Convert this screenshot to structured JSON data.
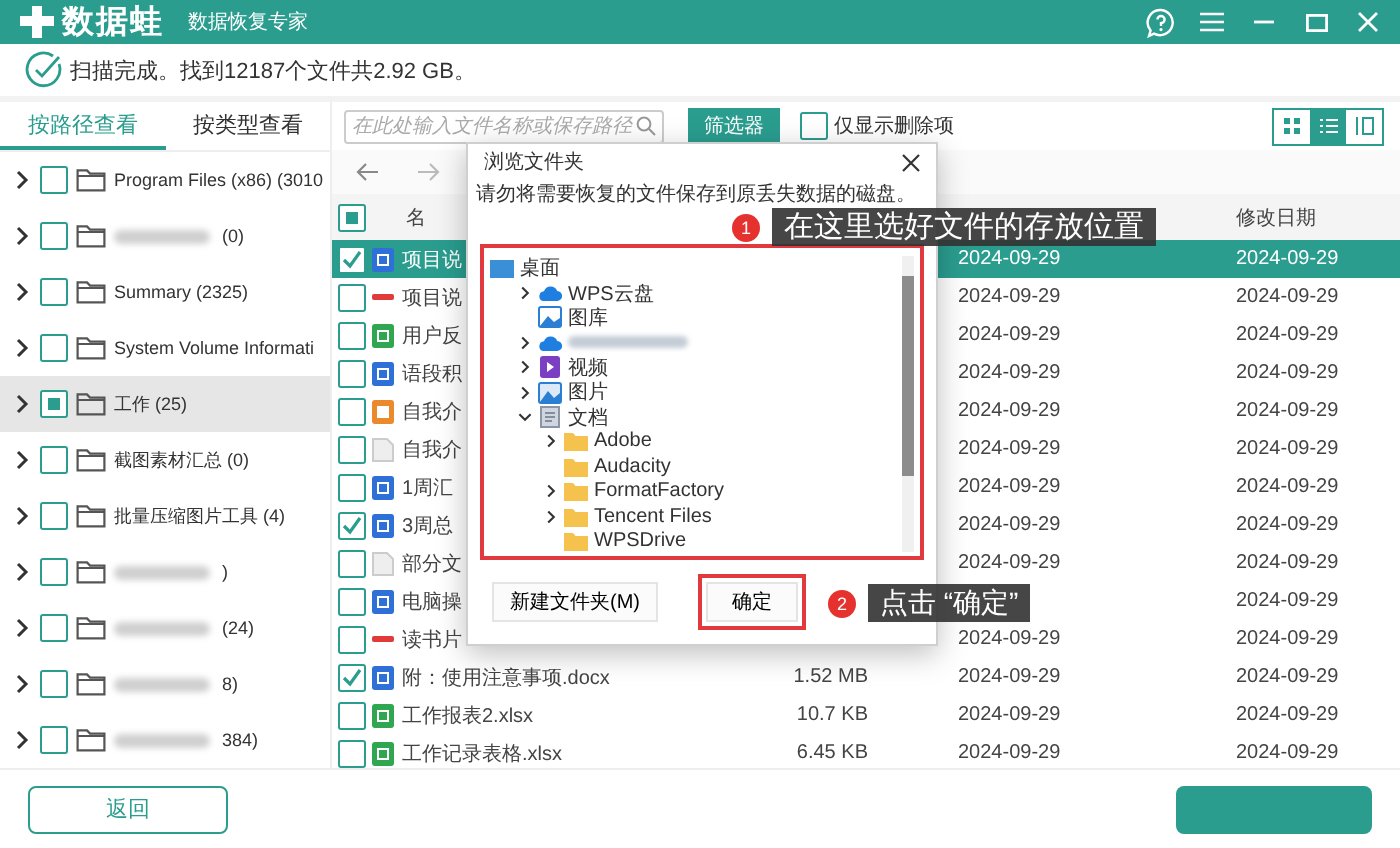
{
  "app": {
    "logo_text": "数据蛙",
    "subtitle": "数据恢复专家"
  },
  "scan_status": "扫描完成。找到12187个文件共2.92 GB。",
  "view_tabs": [
    {
      "label": "按路径查看",
      "selected": true
    },
    {
      "label": "按类型查看",
      "selected": false
    }
  ],
  "tree": [
    {
      "label": "Program Files (x86) (3010",
      "blurred": false,
      "checked": false,
      "indeterminate": false,
      "expanded": false,
      "selected": false
    },
    {
      "label": "(0)",
      "blurred": true,
      "checked": false,
      "indeterminate": false,
      "expanded": false,
      "selected": false
    },
    {
      "label": "Summary (2325)",
      "blurred": false,
      "checked": false,
      "indeterminate": false,
      "expanded": false,
      "selected": false
    },
    {
      "label": "System Volume Informati",
      "blurred": false,
      "checked": false,
      "indeterminate": false,
      "expanded": false,
      "selected": false
    },
    {
      "label": "工作 (25)",
      "blurred": false,
      "checked": false,
      "indeterminate": true,
      "expanded": false,
      "selected": true
    },
    {
      "label": "截图素材汇总 (0)",
      "blurred": false,
      "checked": false,
      "indeterminate": false,
      "expanded": false,
      "selected": false
    },
    {
      "label": "批量压缩图片工具 (4)",
      "blurred": false,
      "checked": false,
      "indeterminate": false,
      "expanded": false,
      "selected": false
    },
    {
      "label": ")",
      "blurred": true,
      "checked": false,
      "indeterminate": false,
      "expanded": false,
      "selected": false
    },
    {
      "label": "(24)",
      "blurred": true,
      "checked": false,
      "indeterminate": false,
      "expanded": false,
      "selected": false
    },
    {
      "label": "8)",
      "blurred": true,
      "checked": false,
      "indeterminate": false,
      "expanded": false,
      "selected": false
    },
    {
      "label": "384)",
      "blurred": true,
      "checked": false,
      "indeterminate": false,
      "expanded": false,
      "selected": false
    }
  ],
  "search": {
    "placeholder": "在此处输入文件名称或保存路径"
  },
  "filter_button": "筛选器",
  "deleted_only": {
    "label": "仅显示删除项",
    "checked": false
  },
  "views": [
    {
      "kind": "grid",
      "selected": false
    },
    {
      "kind": "list",
      "selected": true
    },
    {
      "kind": "columns",
      "selected": false
    }
  ],
  "table": {
    "header": {
      "name": "名",
      "modified": "修改日期"
    },
    "header_checked": false,
    "header_indeterminate": true,
    "rows": [
      {
        "kind": "word",
        "name": "项目说",
        "checked": true,
        "selected": true,
        "created": "2024-09-29",
        "modified": "2024-09-29"
      },
      {
        "kind": "pdf",
        "name": "项目说",
        "checked": false,
        "selected": false,
        "created": "2024-09-29",
        "modified": "2024-09-29"
      },
      {
        "kind": "excel",
        "name": "用户反",
        "checked": false,
        "selected": false,
        "created": "2024-09-29",
        "modified": "2024-09-29"
      },
      {
        "kind": "word",
        "name": "语段积",
        "checked": false,
        "selected": false,
        "created": "2024-09-29",
        "modified": "2024-09-29"
      },
      {
        "kind": "ppt",
        "name": "自我介",
        "checked": false,
        "selected": false,
        "created": "2024-09-29",
        "modified": "2024-09-29"
      },
      {
        "kind": "text",
        "name": "自我介",
        "checked": false,
        "selected": false,
        "created": "2024-09-29",
        "modified": "2024-09-29"
      },
      {
        "kind": "word",
        "name": "1周汇",
        "checked": false,
        "selected": false,
        "created": "2024-09-29",
        "modified": "2024-09-29"
      },
      {
        "kind": "word",
        "name": "3周总",
        "checked": true,
        "selected": false,
        "created": "2024-09-29",
        "modified": "2024-09-29"
      },
      {
        "kind": "text",
        "name": "部分文",
        "checked": false,
        "selected": false,
        "created": "2024-09-29",
        "modified": "2024-09-29"
      },
      {
        "kind": "word",
        "name": "电脑操",
        "checked": false,
        "selected": false,
        "modified": "2024-09-29"
      },
      {
        "kind": "pdf",
        "name": "读书片",
        "checked": false,
        "selected": false,
        "created": "2024-09-29",
        "modified": "2024-09-29"
      },
      {
        "kind": "word",
        "name": "附：使用注意事项.docx",
        "checked": true,
        "selected": false,
        "size": "1.52 MB",
        "created": "2024-09-29",
        "modified": "2024-09-29"
      },
      {
        "kind": "excel",
        "name": "工作报表2.xlsx",
        "checked": false,
        "selected": false,
        "size": "10.7 KB",
        "created": "2024-09-29",
        "modified": "2024-09-29"
      },
      {
        "kind": "excel",
        "name": "工作记录表格.xlsx",
        "checked": false,
        "selected": false,
        "size": "6.45 KB",
        "created": "2024-09-29",
        "modified": "2024-09-29"
      }
    ]
  },
  "dialog": {
    "title": "浏览文件夹",
    "message": "请勿将需要恢复的文件保存到原丢失数据的磁盘。",
    "tree_highlighted": true,
    "tree": [
      {
        "label": "桌面",
        "kind": "desktop",
        "expandable": false,
        "children": [
          {
            "label": "WPS云盘",
            "kind": "cloud",
            "expandable": true,
            "expanded": false
          },
          {
            "label": "图库",
            "kind": "gallery",
            "expandable": false
          },
          {
            "blurred": true,
            "kind": "cloud",
            "expandable": true,
            "expanded": false
          },
          {
            "label": "视频",
            "kind": "video",
            "expandable": true,
            "expanded": false
          },
          {
            "label": "图片",
            "kind": "picture",
            "expandable": true,
            "expanded": false
          },
          {
            "label": "文档",
            "kind": "documents",
            "expandable": true,
            "expanded": true,
            "children": [
              {
                "label": "Adobe",
                "kind": "folder",
                "expandable": true,
                "expanded": false
              },
              {
                "label": "Audacity",
                "kind": "folder",
                "expandable": false
              },
              {
                "label": "FormatFactory",
                "kind": "folder",
                "expandable": true,
                "expanded": false
              },
              {
                "label": "Tencent Files",
                "kind": "folder",
                "expandable": true,
                "expanded": false
              },
              {
                "label": "WPSDrive",
                "kind": "folder",
                "expandable": false
              }
            ]
          }
        ]
      }
    ],
    "buttons": [
      {
        "label": "新建文件夹(M)",
        "highlighted": false
      },
      {
        "label": "确定",
        "highlighted": true
      }
    ]
  },
  "callouts": [
    {
      "number": "1",
      "text": "在这里选好文件的存放位置"
    },
    {
      "number": "2",
      "text": "点击 “确定”"
    }
  ],
  "back_button": "返回"
}
